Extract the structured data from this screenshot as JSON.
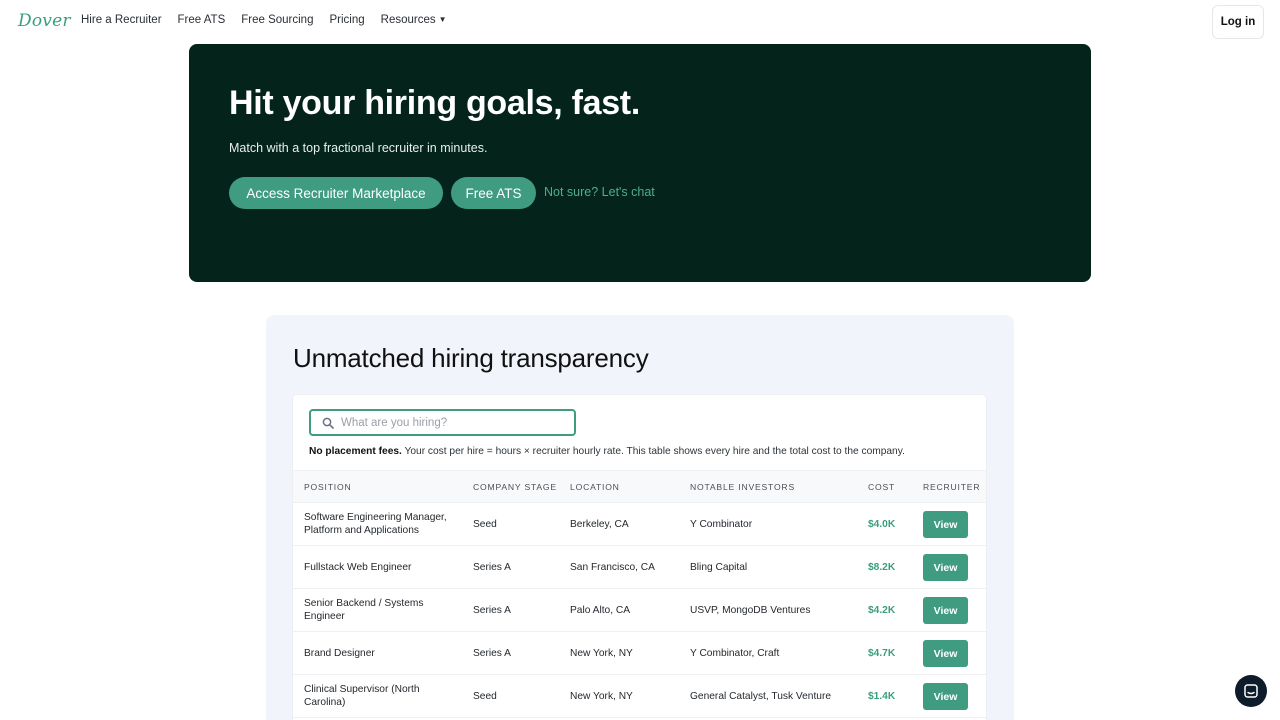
{
  "nav": {
    "logo": "Dover",
    "links": [
      "Hire a Recruiter",
      "Free ATS",
      "Free Sourcing",
      "Pricing",
      "Resources"
    ],
    "login": "Log in"
  },
  "hero": {
    "title": "Hit your hiring goals, fast.",
    "subtitle": "Match with a top fractional recruiter in minutes.",
    "primary_button": "Access Recruiter Marketplace",
    "secondary_button": "Free ATS",
    "chat_link": "Not sure? Let's chat"
  },
  "transparency": {
    "title": "Unmatched hiring transparency",
    "search_placeholder": "What are you hiring?",
    "note_bold": "No placement fees.",
    "note_text": " Your cost per hire = hours × recruiter hourly rate. This table shows every hire and the total cost to the company.",
    "columns": [
      "Position",
      "Company Stage",
      "Location",
      "Notable Investors",
      "Cost",
      "Recruiter"
    ],
    "rows": [
      {
        "position": "Software Engineering Manager, Platform and Applications",
        "stage": "Seed",
        "location": "Berkeley, CA",
        "investors": "Y Combinator",
        "cost": "$4.0K",
        "action": "View"
      },
      {
        "position": "Fullstack Web Engineer",
        "stage": "Series A",
        "location": "San Francisco, CA",
        "investors": "Bling Capital",
        "cost": "$8.2K",
        "action": "View"
      },
      {
        "position": "Senior Backend / Systems Engineer",
        "stage": "Series A",
        "location": "Palo Alto, CA",
        "investors": "USVP, MongoDB Ventures",
        "cost": "$4.2K",
        "action": "View"
      },
      {
        "position": "Brand Designer",
        "stage": "Series A",
        "location": "New York, NY",
        "investors": "Y Combinator, Craft",
        "cost": "$4.7K",
        "action": "View"
      },
      {
        "position": "Clinical Supervisor (North Carolina)",
        "stage": "Seed",
        "location": "New York, NY",
        "investors": "General Catalyst, Tusk Venture",
        "cost": "$1.4K",
        "action": "View"
      }
    ]
  },
  "colors": {
    "brand_green": "#3f9c80",
    "hero_bg": "#03231b",
    "panel_bg": "#f1f4fb"
  },
  "icons": [
    "search-icon",
    "caret-down-icon",
    "chat-icon"
  ]
}
